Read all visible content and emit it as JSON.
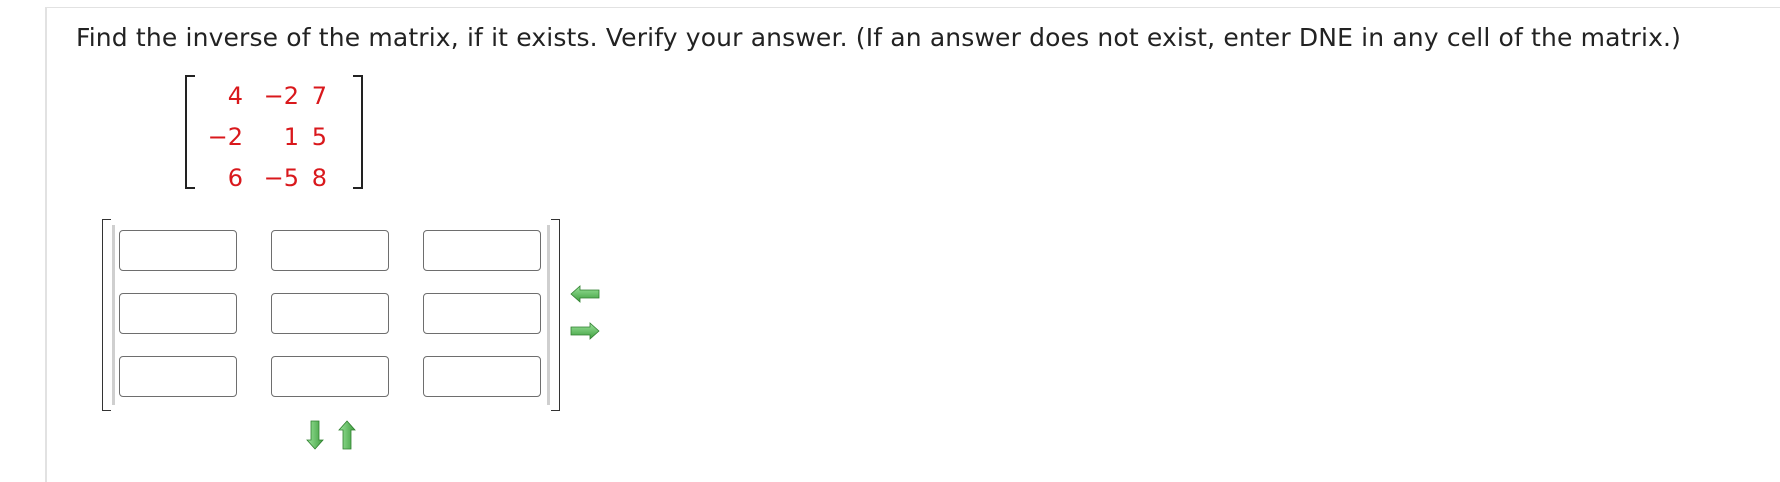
{
  "question": {
    "text": "Find the inverse of the matrix, if it exists. Verify your answer. (If an answer does not exist, enter DNE in any cell of the matrix.)"
  },
  "given_matrix": {
    "rows": [
      [
        "4",
        "−2",
        "7"
      ],
      [
        "−2",
        "1",
        "5"
      ],
      [
        "6",
        "−5",
        "8"
      ]
    ],
    "color": "#d9181c"
  },
  "answer_matrix": {
    "rows": [
      [
        "",
        "",
        ""
      ],
      [
        "",
        "",
        ""
      ],
      [
        "",
        "",
        ""
      ]
    ]
  },
  "controls": {
    "remove_column_icon": "arrow-left-icon",
    "add_column_icon": "arrow-right-icon",
    "add_row_icon": "arrow-down-icon",
    "remove_row_icon": "arrow-up-icon",
    "arrow_color": "#4caf50"
  }
}
